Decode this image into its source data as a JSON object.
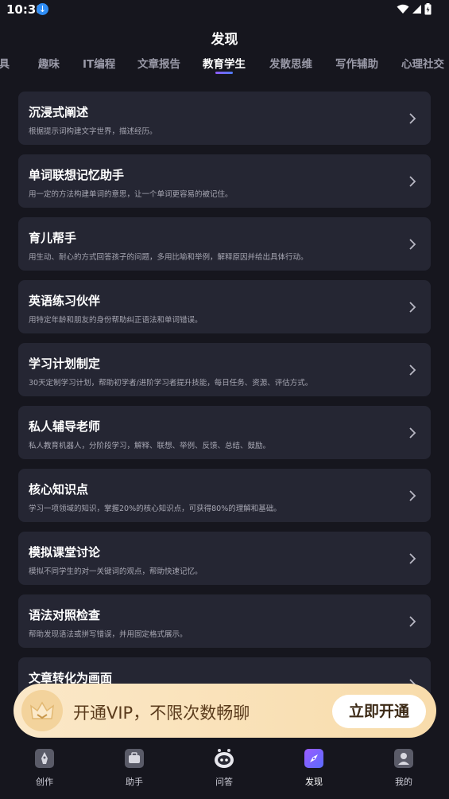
{
  "status_bar": {
    "time": "10:38"
  },
  "header": {
    "title": "发现"
  },
  "tabs": [
    {
      "label": "工具"
    },
    {
      "label": "趣味"
    },
    {
      "label": "IT编程"
    },
    {
      "label": "文章报告"
    },
    {
      "label": "教育学生",
      "active": true
    },
    {
      "label": "发散思维"
    },
    {
      "label": "写作辅助"
    },
    {
      "label": "心理社交"
    }
  ],
  "cards": [
    {
      "title": "沉浸式阐述",
      "desc": "根据提示词构建文字世界，描述经历。"
    },
    {
      "title": "单词联想记忆助手",
      "desc": "用一定的方法构建单词的意思，让一个单词更容易的被记住。"
    },
    {
      "title": "育儿帮手",
      "desc": "用生动、耐心的方式回答孩子的问题，多用比喻和举例，解释原因并给出具体行动。"
    },
    {
      "title": "英语练习伙伴",
      "desc": "用特定年龄和朋友的身份帮助纠正语法和单词错误。"
    },
    {
      "title": "学习计划制定",
      "desc": "30天定制学习计划，帮助初学者/进阶学习者提升技能，每日任务、资源、评估方式。"
    },
    {
      "title": "私人辅导老师",
      "desc": "私人教育机器人，分阶段学习，解释、联想、举例、反馈、总结、鼓励。"
    },
    {
      "title": "核心知识点",
      "desc": "学习一项领域的知识，掌握20%的核心知识点，可获得80%的理解和基础。"
    },
    {
      "title": "模拟课堂讨论",
      "desc": "模拟不同学生的对一关键词的观点，帮助快速记忆。"
    },
    {
      "title": "语法对照检查",
      "desc": "帮助发现语法或拼写错误，并用固定格式展示。"
    },
    {
      "title": "文章转化为画面",
      "desc": ""
    }
  ],
  "vip": {
    "text": "开通VIP，不限次数畅聊",
    "button": "立即开通"
  },
  "bottom_nav": [
    {
      "label": "创作",
      "icon": "pen-icon"
    },
    {
      "label": "助手",
      "icon": "briefcase-icon"
    },
    {
      "label": "问答",
      "icon": "robot-icon"
    },
    {
      "label": "发现",
      "icon": "compass-icon",
      "active": true
    },
    {
      "label": "我的",
      "icon": "user-icon"
    }
  ],
  "colors": {
    "background": "#16161e",
    "card": "#252633",
    "accent": "#7a5cff",
    "vip_banner": "#f8dcab"
  }
}
